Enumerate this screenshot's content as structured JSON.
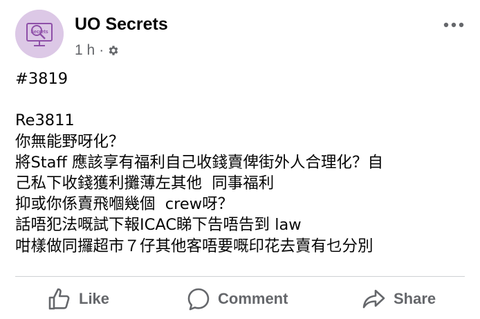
{
  "post": {
    "page_name": "UO Secrets",
    "timestamp": "1 h",
    "separator": "·",
    "avatar_logo_text": "Secrets",
    "privacy_icon": "gear-icon",
    "more_icon": "more-dots-icon",
    "body_lines": [
      "#3819",
      "",
      "Re3811",
      "你無能野呀化？",
      "將Staff 應該享有福利自己收錢賣俾街外人合理化？自",
      "己私下收錢獲利攤薄左其他  同事福利",
      "抑或你係賣飛嗰幾個  crew呀？",
      "話唔犯法嘅試下報ICAC睇下告唔告到 law",
      "咁樣做同攞超市７仔其他客唔要嘅印花去賣有乜分別"
    ]
  },
  "actions": {
    "like_label": "Like",
    "comment_label": "Comment",
    "share_label": "Share"
  },
  "colors": {
    "text": "#050505",
    "secondary_text": "#65676b",
    "avatar_bg": "#dcc8e6",
    "logo_purple": "#8e4fa8",
    "divider": "#ced0d4"
  }
}
